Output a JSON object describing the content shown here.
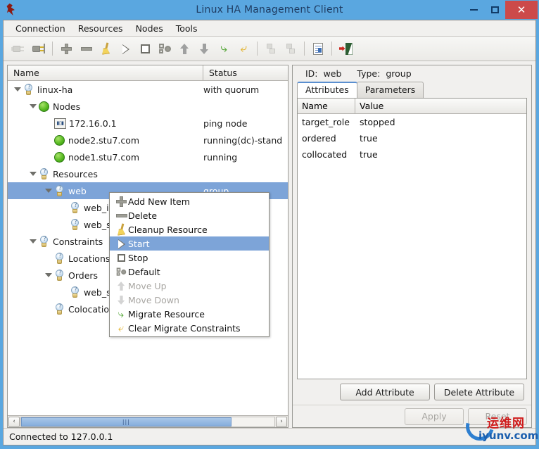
{
  "window": {
    "title": "Linux HA Management Client",
    "app_icon": "penguin-icon",
    "minimize_label": "–",
    "maximize_label": "□",
    "close_label": "✕",
    "accent_blue": "#5aa7e0",
    "close_red": "#cc4a4a",
    "selection_blue": "#7da4d8"
  },
  "menubar": {
    "items": [
      {
        "label": "Connection",
        "name": "menu-connection"
      },
      {
        "label": "Resources",
        "name": "menu-resources"
      },
      {
        "label": "Nodes",
        "name": "menu-nodes"
      },
      {
        "label": "Tools",
        "name": "menu-tools"
      }
    ]
  },
  "toolbar": {
    "buttons": [
      {
        "icon": "disconnect-icon",
        "enabled": false
      },
      {
        "icon": "connect-icon",
        "enabled": true
      },
      {
        "icon": "add-icon",
        "enabled": true
      },
      {
        "icon": "remove-icon",
        "enabled": true
      },
      {
        "icon": "cleanup-broom-icon",
        "enabled": true
      },
      {
        "icon": "start-play-icon",
        "enabled": true
      },
      {
        "icon": "stop-square-icon",
        "enabled": true
      },
      {
        "icon": "default-gears-icon",
        "enabled": true
      },
      {
        "icon": "move-up-icon",
        "enabled": true
      },
      {
        "icon": "move-down-icon",
        "enabled": true
      },
      {
        "icon": "migrate-resource-icon",
        "enabled": true
      },
      {
        "icon": "clear-migrate-icon",
        "enabled": true
      },
      {
        "icon": "node-standby-icon",
        "enabled": false
      },
      {
        "icon": "node-online-icon",
        "enabled": false
      },
      {
        "icon": "document-icon",
        "enabled": true
      },
      {
        "icon": "exit-icon",
        "enabled": true
      }
    ]
  },
  "tree": {
    "columns": {
      "name": "Name",
      "status": "Status"
    },
    "rows": [
      {
        "indent": 0,
        "twisty": "down",
        "icon": "bulb-icon",
        "label": "linux-ha",
        "status": "with quorum",
        "selected": false
      },
      {
        "indent": 1,
        "twisty": "down",
        "icon": "green-icon",
        "label": "Nodes",
        "status": "",
        "selected": false
      },
      {
        "indent": 2,
        "twisty": "none",
        "icon": "ip-icon",
        "label": "172.16.0.1",
        "status": "ping node",
        "selected": false
      },
      {
        "indent": 2,
        "twisty": "none",
        "icon": "green-icon",
        "label": "node2.stu7.com",
        "status": "running(dc)-stand",
        "selected": false
      },
      {
        "indent": 2,
        "twisty": "none",
        "icon": "green-icon",
        "label": "node1.stu7.com",
        "status": "running",
        "selected": false
      },
      {
        "indent": 1,
        "twisty": "down",
        "icon": "bulb-icon",
        "label": "Resources",
        "status": "",
        "selected": false
      },
      {
        "indent": 2,
        "twisty": "down",
        "icon": "bulb-icon",
        "label": "web",
        "status": "group",
        "selected": true
      },
      {
        "indent": 3,
        "twisty": "none",
        "icon": "bulb-icon",
        "label": "web_ip",
        "status": "",
        "selected": false
      },
      {
        "indent": 3,
        "twisty": "none",
        "icon": "bulb-icon",
        "label": "web_se",
        "status": "",
        "selected": false
      },
      {
        "indent": 1,
        "twisty": "down",
        "icon": "bulb-icon",
        "label": "Constraints",
        "status": "",
        "selected": false
      },
      {
        "indent": 2,
        "twisty": "none",
        "icon": "bulb-icon",
        "label": "Locations",
        "status": "",
        "selected": false
      },
      {
        "indent": 2,
        "twisty": "down",
        "icon": "bulb-icon",
        "label": "Orders",
        "status": "",
        "selected": false
      },
      {
        "indent": 3,
        "twisty": "none",
        "icon": "bulb-icon",
        "label": "web_se",
        "status": "",
        "selected": false
      },
      {
        "indent": 2,
        "twisty": "none",
        "icon": "bulb-icon",
        "label": "Colocation",
        "status": "",
        "selected": false
      }
    ],
    "hscroll": {
      "left_arrow": "‹",
      "right_arrow": "›",
      "grip": "|||"
    }
  },
  "context_menu": {
    "items": [
      {
        "label": "Add New Item",
        "icon": "plus-icon",
        "state": "normal"
      },
      {
        "label": "Delete",
        "icon": "minus-icon",
        "state": "normal"
      },
      {
        "label": "Cleanup Resource",
        "icon": "broom-icon",
        "state": "normal"
      },
      {
        "label": "Start",
        "icon": "play-icon",
        "state": "highlight"
      },
      {
        "label": "Stop",
        "icon": "stop-icon",
        "state": "normal"
      },
      {
        "label": "Default",
        "icon": "gears-icon",
        "state": "normal"
      },
      {
        "label": "Move Up",
        "icon": "arrow-up-icon",
        "state": "disabled"
      },
      {
        "label": "Move Down",
        "icon": "arrow-down-icon",
        "state": "disabled"
      },
      {
        "label": "Migrate Resource",
        "icon": "migrate-icon",
        "state": "normal"
      },
      {
        "label": "Clear Migrate Constraints",
        "icon": "clear-migrate-icon",
        "state": "normal"
      }
    ]
  },
  "details": {
    "id_label": "ID:",
    "id_value": "web",
    "type_label": "Type:",
    "type_value": "group",
    "tabs": [
      {
        "label": "Attributes",
        "active": true
      },
      {
        "label": "Parameters",
        "active": false
      }
    ],
    "table": {
      "columns": {
        "name": "Name",
        "value": "Value"
      },
      "rows": [
        {
          "name": "target_role",
          "value": "stopped"
        },
        {
          "name": "ordered",
          "value": "true"
        },
        {
          "name": "collocated",
          "value": "true"
        }
      ]
    },
    "buttons": {
      "add_attribute": "Add Attribute",
      "delete_attribute": "Delete Attribute",
      "apply": "Apply",
      "reset": "Reset"
    }
  },
  "statusbar": {
    "text": "Connected to 127.0.0.1"
  },
  "watermark": {
    "cn_text": "运维网",
    "domain_text": "iyunv.com"
  }
}
